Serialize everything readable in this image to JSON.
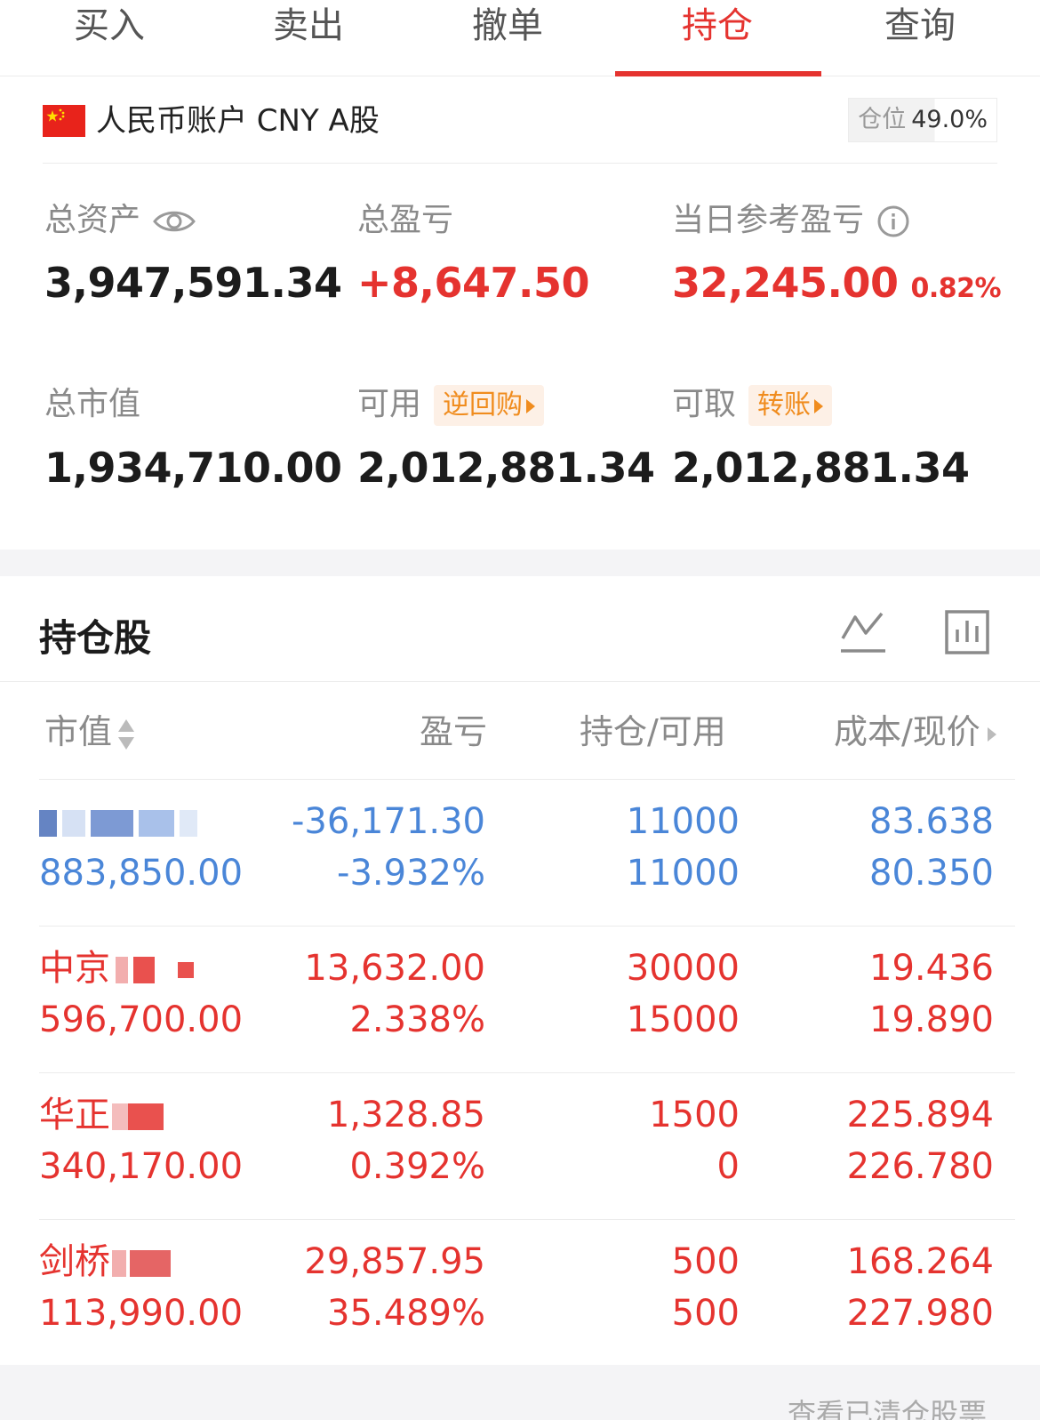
{
  "tabs": [
    {
      "label": "买入",
      "active": false
    },
    {
      "label": "卖出",
      "active": false
    },
    {
      "label": "撤单",
      "active": false
    },
    {
      "label": "持仓",
      "active": true
    },
    {
      "label": "查询",
      "active": false
    }
  ],
  "account": {
    "flag_icon": "cn-flag-icon",
    "label": "人民币账户 CNY A股",
    "position_ratio_label": "仓位",
    "position_ratio_value": "49.0%"
  },
  "summary": {
    "total_assets": {
      "label": "总资产",
      "value": "3,947,591.34",
      "icon": "eye-icon"
    },
    "total_pnl": {
      "label": "总盈亏",
      "value": "+8,647.50"
    },
    "daily_pnl": {
      "label": "当日参考盈亏",
      "value": "32,245.00",
      "percent": "0.82%",
      "icon": "info-icon"
    },
    "market_value": {
      "label": "总市值",
      "value": "1,934,710.00"
    },
    "available": {
      "label": "可用",
      "value": "2,012,881.34",
      "action": "逆回购"
    },
    "withdrawable": {
      "label": "可取",
      "value": "2,012,881.34",
      "action": "转账"
    }
  },
  "holdings": {
    "title": "持仓股",
    "icons": [
      "line-chart-icon",
      "bar-chart-icon"
    ],
    "columns": [
      "市值",
      "盈亏",
      "持仓/可用",
      "成本/现价"
    ],
    "rows": [
      {
        "name": "",
        "market_value": "883,850.00",
        "pnl": "-36,171.30",
        "pnl_pct": "-3.932%",
        "position": "11000",
        "available": "11000",
        "cost": "83.638",
        "price": "80.350",
        "color": "#4a86d8"
      },
      {
        "name": "中京",
        "market_value": "596,700.00",
        "pnl": "13,632.00",
        "pnl_pct": "2.338%",
        "position": "30000",
        "available": "15000",
        "cost": "19.436",
        "price": "19.890",
        "color": "#e5332f"
      },
      {
        "name": "华正",
        "market_value": "340,170.00",
        "pnl": "1,328.85",
        "pnl_pct": "0.392%",
        "position": "1500",
        "available": "0",
        "cost": "225.894",
        "price": "226.780",
        "color": "#e5332f"
      },
      {
        "name": "剑桥",
        "market_value": "113,990.00",
        "pnl": "29,857.95",
        "pnl_pct": "35.489%",
        "position": "500",
        "available": "500",
        "cost": "168.264",
        "price": "227.980",
        "color": "#e5332f"
      }
    ]
  },
  "footer": {
    "link": "查看已清仓股票"
  }
}
